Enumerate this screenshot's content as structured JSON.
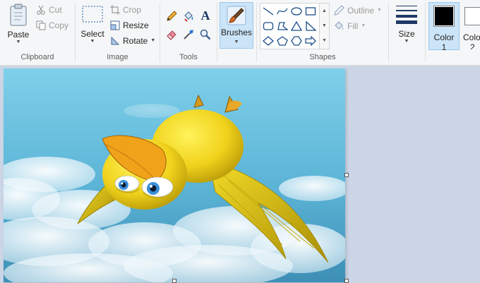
{
  "ribbon": {
    "clipboard": {
      "group_label": "Clipboard",
      "paste_label": "Paste",
      "cut_label": "Cut",
      "copy_label": "Copy"
    },
    "image": {
      "group_label": "Image",
      "select_label": "Select",
      "crop_label": "Crop",
      "resize_label": "Resize",
      "rotate_label": "Rotate"
    },
    "tools": {
      "group_label": "Tools",
      "items": [
        "pencil-icon",
        "fill-bucket-icon",
        "text-icon",
        "eraser-icon",
        "color-picker-icon",
        "magnifier-icon"
      ]
    },
    "brushes": {
      "label": "Brushes"
    },
    "shapes": {
      "group_label": "Shapes",
      "outline_label": "Outline",
      "fill_label": "Fill",
      "items": [
        "line-shape-icon",
        "curve-shape-icon",
        "oval-shape-icon",
        "rectangle-shape-icon",
        "rounded-rectangle-shape-icon",
        "polygon-shape-icon",
        "triangle-shape-icon",
        "right-triangle-shape-icon",
        "diamond-shape-icon",
        "pentagon-shape-icon",
        "hexagon-shape-icon",
        "right-arrow-shape-icon"
      ]
    },
    "size": {
      "label": "Size"
    },
    "color1": {
      "label_line1": "Color",
      "label_line2": "1",
      "color": "#000000"
    },
    "color2": {
      "label_line1": "Colo",
      "label_line2": "2",
      "color": "#ffffff"
    }
  },
  "colors": {
    "accent": "#cce4f7",
    "accent_border": "#99c9ef",
    "workspace": "#cbd5e6"
  },
  "canvas": {
    "content": "Cartoon yellow bird flying over sky with clouds"
  }
}
